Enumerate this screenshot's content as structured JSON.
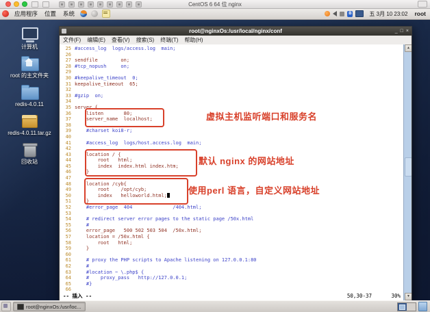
{
  "vm_window": {
    "title": "CentOS 6 64 位 nginx"
  },
  "panel": {
    "menus": [
      "应用程序",
      "位置",
      "系统"
    ],
    "left_icons": [
      "redhat-menu-icon",
      "firefox-icon",
      "launcher-icon",
      "notes-icon"
    ],
    "right_icons": [
      "network-activity-icon",
      "volume-icon",
      "input-method-icon",
      "bluetooth-icon",
      "network-icon"
    ],
    "clock": "五 3月 10 23:02",
    "user": "root"
  },
  "desktop": {
    "icons": [
      {
        "label": "计算机",
        "type": "computer"
      },
      {
        "label": "root 的主文件夹",
        "type": "home"
      },
      {
        "label": "redis-4.0.11",
        "type": "folder"
      },
      {
        "label": "redis-4.0.11.tar.gz",
        "type": "archive"
      },
      {
        "label": "回收站",
        "type": "trash"
      }
    ]
  },
  "terminal": {
    "title": "root@nginxOs:/usr/local/nginx/conf",
    "menus": [
      "文件(F)",
      "编辑(E)",
      "查看(V)",
      "搜索(S)",
      "终端(T)",
      "帮助(H)"
    ],
    "status": {
      "mode": "-- 插入 --",
      "cursor_position": "50,30-37",
      "scroll_percent": "30%"
    },
    "lines": [
      {
        "n": 25,
        "text": "#access_log  logs/access.log  main;",
        "kind": "comment"
      },
      {
        "n": 26,
        "text": "",
        "kind": "blank"
      },
      {
        "n": 27,
        "text": "sendfile        on;",
        "kind": "code"
      },
      {
        "n": 28,
        "text": "#tcp_nopush     on;",
        "kind": "comment"
      },
      {
        "n": 29,
        "text": "",
        "kind": "blank"
      },
      {
        "n": 30,
        "text": "#keepalive_timeout  0;",
        "kind": "comment"
      },
      {
        "n": 31,
        "text": "keepalive_timeout  65;",
        "kind": "code"
      },
      {
        "n": 32,
        "text": "",
        "kind": "blank"
      },
      {
        "n": 33,
        "text": "#gzip  on;",
        "kind": "comment"
      },
      {
        "n": 34,
        "text": "",
        "kind": "blank"
      },
      {
        "n": 35,
        "text": "server {",
        "kind": "code"
      },
      {
        "n": 36,
        "text": "    listen       80;",
        "kind": "code"
      },
      {
        "n": 37,
        "text": "    server_name  localhost;",
        "kind": "code"
      },
      {
        "n": 38,
        "text": "",
        "kind": "blank"
      },
      {
        "n": 39,
        "text": "    #charset koi8-r;",
        "kind": "comment"
      },
      {
        "n": 40,
        "text": "",
        "kind": "blank"
      },
      {
        "n": 41,
        "text": "    #access_log  logs/host.access.log  main;",
        "kind": "comment"
      },
      {
        "n": 42,
        "text": "",
        "kind": "blank"
      },
      {
        "n": 43,
        "text": "    location / {",
        "kind": "code"
      },
      {
        "n": 44,
        "text": "        root   html;",
        "kind": "code"
      },
      {
        "n": 45,
        "text": "        index  index.html index.htm;",
        "kind": "code"
      },
      {
        "n": 46,
        "text": "    }",
        "kind": "code"
      },
      {
        "n": 47,
        "text": "",
        "kind": "blank"
      },
      {
        "n": 48,
        "text": "    location /cyb{",
        "kind": "code"
      },
      {
        "n": 49,
        "text": "        root    /opt/cyb;",
        "kind": "code"
      },
      {
        "n": 50,
        "text": "        index   helloworld.html;",
        "kind": "code",
        "cursor": true
      },
      {
        "n": 51,
        "text": "    }",
        "kind": "code"
      },
      {
        "n": 52,
        "text": "    #error_page  404              /404.html;",
        "kind": "comment"
      },
      {
        "n": 53,
        "text": "",
        "kind": "blank"
      },
      {
        "n": 54,
        "text": "    # redirect server error pages to the static page /50x.html",
        "kind": "comment"
      },
      {
        "n": 55,
        "text": "    #",
        "kind": "comment"
      },
      {
        "n": 56,
        "text": "    error_page   500 502 503 504  /50x.html;",
        "kind": "code"
      },
      {
        "n": 57,
        "text": "    location = /50x.html {",
        "kind": "code"
      },
      {
        "n": 58,
        "text": "        root   html;",
        "kind": "code"
      },
      {
        "n": 59,
        "text": "    }",
        "kind": "code"
      },
      {
        "n": 60,
        "text": "",
        "kind": "blank"
      },
      {
        "n": 61,
        "text": "    # proxy the PHP scripts to Apache listening on 127.0.0.1:80",
        "kind": "comment"
      },
      {
        "n": 62,
        "text": "    #",
        "kind": "comment"
      },
      {
        "n": 63,
        "text": "    #location ~ \\.php$ {",
        "kind": "comment"
      },
      {
        "n": 64,
        "text": "    #    proxy_pass   http://127.0.0.1;",
        "kind": "comment"
      },
      {
        "n": 65,
        "text": "    #}",
        "kind": "comment"
      },
      {
        "n": 66,
        "text": "",
        "kind": "blank"
      }
    ]
  },
  "annotations": [
    {
      "text": "虚拟主机监听端口和服务名"
    },
    {
      "text": "默认 nginx 的网站地址"
    },
    {
      "text": "使用perl 语言，自定义网站地址"
    }
  ],
  "taskbar": {
    "task_label": "root@nginxOs:/usr/loc..."
  },
  "colors": {
    "annotation_red": "#d8402a",
    "code_text": "#8f3022",
    "comment_text": "#3c42c8",
    "line_number": "#bb8a2a",
    "desktop_top": "#35496d",
    "desktop_bottom": "#0e1830",
    "scrollbar": "#b9cfe8"
  }
}
